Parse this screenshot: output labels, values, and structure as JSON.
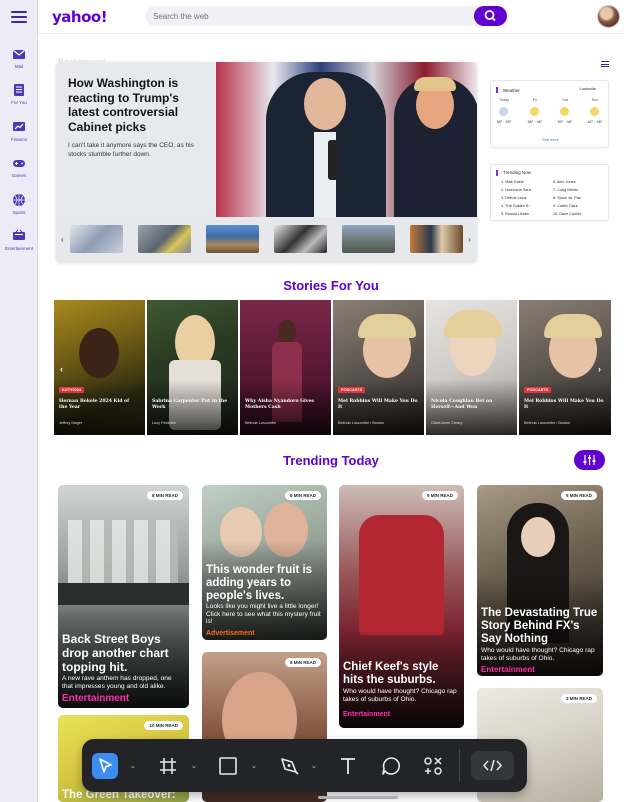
{
  "brand": {
    "logo": "yahoo!",
    "accent": "#6001d2"
  },
  "search": {
    "placeholder": "Search the web",
    "icon": "search-icon"
  },
  "sidebar": {
    "menu_icon": "hamburger-icon",
    "items": [
      {
        "label": "Mail",
        "icon": "mail-icon"
      },
      {
        "label": "For You",
        "icon": "for-you-icon"
      },
      {
        "label": "Finance",
        "icon": "finance-icon"
      },
      {
        "label": "Games",
        "icon": "games-icon"
      },
      {
        "label": "Sports",
        "icon": "sports-icon"
      },
      {
        "label": "Entertainment",
        "icon": "entertainment-icon"
      }
    ]
  },
  "hero": {
    "faint_label": "Background",
    "title": "How Washington is reacting to Trump's latest controversial Cabinet picks",
    "description": "I can't take it anymore says the CEO, as his stocks stumble further down."
  },
  "weather": {
    "title": "Weather",
    "location": "Louisville",
    "days": [
      {
        "day": "Today",
        "temps": "58° · 50°"
      },
      {
        "day": "Fri",
        "temps": "56° · 46°"
      },
      {
        "day": "Sat",
        "temps": "59° · 46°"
      },
      {
        "day": "Sun",
        "temps": "62° · 48°"
      }
    ],
    "more_label": "See more"
  },
  "trending_now": {
    "title": "Trending Now",
    "items": [
      "1. Matt Gaetz",
      "2. Hurricane Sara",
      "3. Detroit Lions",
      "4. The Golden B.",
      "5. Russia-Ukrain",
      "6. Alex Jones",
      "7. Craig Melvin",
      "8. Tyson vs. Pau",
      "9. Caitlin Clark",
      "10. Dave Coulier"
    ]
  },
  "stories": {
    "heading": "Stories For You",
    "items": [
      {
        "tag": "KOTY2024",
        "caption": "Hernan Bekele 2024 Kid of the Year",
        "byline": "Jeffrey Mager"
      },
      {
        "tag": "",
        "caption": "Sabrina Carpenter Put In the Work",
        "byline": "Lucy Feldman"
      },
      {
        "tag": "",
        "caption": "Why Aisha Nyandoro Gives Mothers Cash",
        "byline": "Belinda Luscombe"
      },
      {
        "tag": "PODCASTS",
        "caption": "Mel Robbins Will Make You Do It",
        "byline": "Belinda Luscombe / Boston"
      },
      {
        "tag": "",
        "caption": "Nicola Coughlan Bet on Herself—And Won",
        "byline": "Olivia Anne Cleary"
      },
      {
        "tag": "PODCASTS",
        "caption": "Mel Robbins Will Make You Do It",
        "byline": "Belinda Luscombe / Boston"
      }
    ]
  },
  "trending_today": {
    "heading": "Trending Today",
    "tiles": [
      {
        "badge": "8 MIN READ",
        "title": "Back Street Boys drop another chart topping hit.",
        "sub": "A new rave anthem has dropped, one that impresses young and old alike.",
        "category": "Entertainment"
      },
      {
        "badge": "8 MIN READ",
        "title": "This wonder fruit is adding years to people's lives.",
        "sub": "Looks like you might live a little longer! Click here to see what this mystery fruit is!",
        "category": "Advertisement"
      },
      {
        "badge": "9 MIN READ",
        "title": "Chief Keef's style hits the suburbs.",
        "sub": "Who would have thought? Chicago rap takes of suburbs of Ohio.",
        "category": "Entertainment"
      },
      {
        "badge": "5 MIN READ",
        "title": "The Devastating True Story Behind FX's Say Nothing",
        "sub": "Who would have thought? Chicago rap takes of suburbs of Ohio.",
        "category": "Entertainment"
      },
      {
        "badge": "8 MIN READ"
      },
      {
        "badge": "10 MIN READ",
        "title": "The Green Takeover:"
      },
      {
        "badge": "3 MIN READ"
      }
    ]
  }
}
